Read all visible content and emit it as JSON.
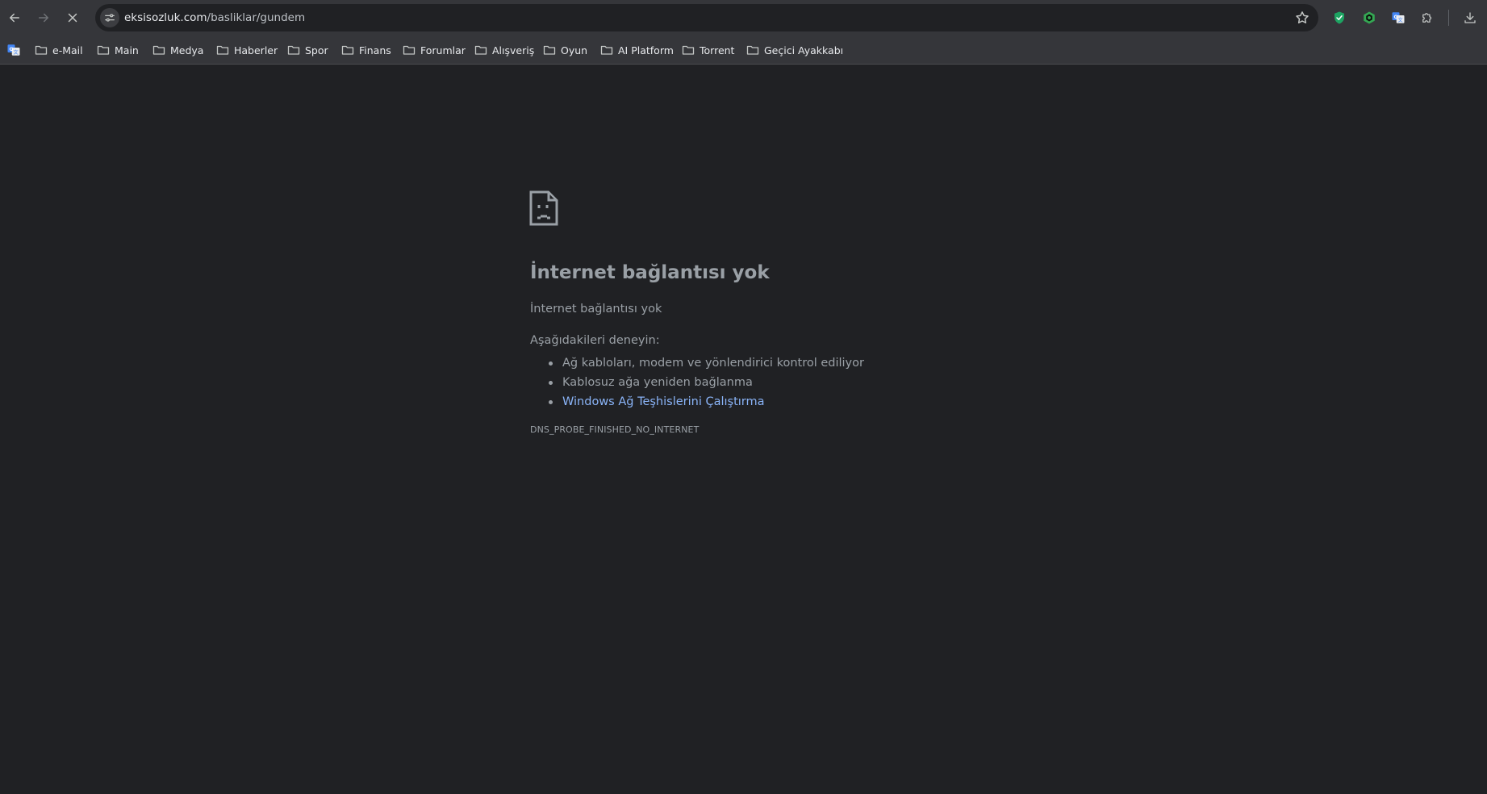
{
  "browser": {
    "address_bar": {
      "url_domain": "eksisozluk.com",
      "url_path": "/basliklar/gundem"
    },
    "nav": {
      "back_icon": "arrow-left-icon",
      "forward_icon": "arrow-right-icon",
      "stop_icon": "close-icon"
    },
    "extensions": [
      {
        "icon": "shield-check-icon",
        "color": "#1da462"
      },
      {
        "icon": "hexagon-icon",
        "color": "#34a853"
      },
      {
        "icon": "google-translate-icon",
        "color": "#4285f4"
      },
      {
        "icon": "puzzle-icon",
        "color": "#c4c7c5"
      }
    ],
    "download_icon": "download-icon"
  },
  "bookmarks": {
    "items": [
      {
        "label": "e-Mail"
      },
      {
        "label": "Main"
      },
      {
        "label": "Medya"
      },
      {
        "label": "Haberler"
      },
      {
        "label": "Spor"
      },
      {
        "label": "Finans"
      },
      {
        "label": "Forumlar"
      },
      {
        "label": "Alışveriş"
      },
      {
        "label": "Oyun"
      },
      {
        "label": "AI Platform"
      },
      {
        "label": "Torrent"
      },
      {
        "label": "Geçici Ayakkabı"
      }
    ]
  },
  "error": {
    "title": "İnternet bağlantısı yok",
    "subtitle": "İnternet bağlantısı yok",
    "try_label": "Aşağıdakileri deneyin:",
    "suggestions": [
      "Ağ kabloları, modem ve yönlendirici kontrol ediliyor",
      "Kablosuz ağa yeniden bağlanma"
    ],
    "diagnostics_link": "Windows Ağ Teşhislerini Çalıştırma",
    "code": "DNS_PROBE_FINISHED_NO_INTERNET"
  },
  "colors": {
    "page_bg": "#202124",
    "toolbar_bg": "#35363a",
    "text_secondary": "#9aa0a6",
    "link": "#8ab4f8"
  }
}
